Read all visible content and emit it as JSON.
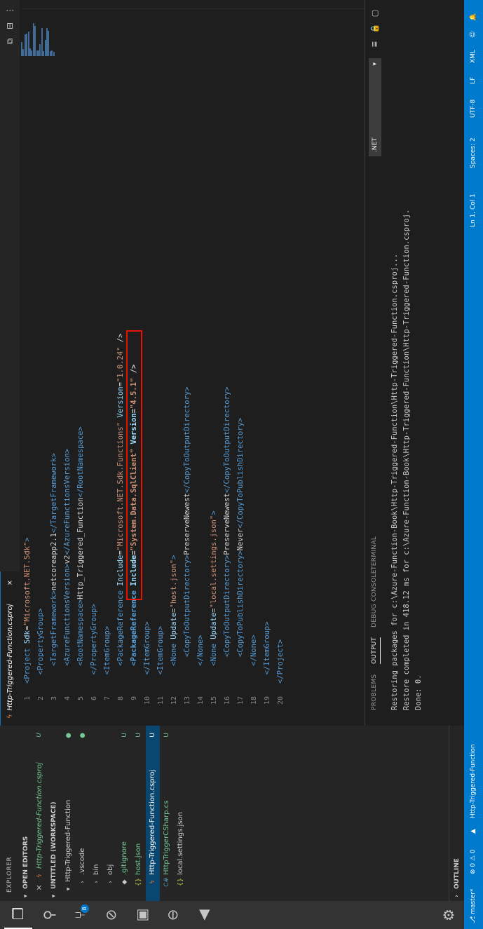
{
  "activity_bar": {
    "items": [
      {
        "name": "explorer-icon",
        "glyph": "❐"
      },
      {
        "name": "search-icon",
        "glyph": "⚲"
      },
      {
        "name": "source-control-icon",
        "glyph": "⑂",
        "badge": "8"
      },
      {
        "name": "debug-icon",
        "glyph": "⊘"
      },
      {
        "name": "extensions-icon",
        "glyph": "▣"
      },
      {
        "name": "azure-icon",
        "glyph": "⊖"
      },
      {
        "name": "deploy-icon",
        "glyph": "◀"
      }
    ],
    "settings_glyph": "⚙"
  },
  "sidebar": {
    "title": "EXPLORER",
    "open_editors_label": "OPEN EDITORS",
    "open_editor_item": {
      "close": "×",
      "name": "Http-Triggered-Function.csproj",
      "git": "U"
    },
    "workspace_label": "UNTITLED (WORKSPACE)",
    "tree": [
      {
        "name": "Http-Triggered-Function",
        "icon": "▾",
        "git": "●",
        "indent": 1
      },
      {
        "name": ".vscode",
        "icon": "›",
        "git": "●",
        "indent": 2
      },
      {
        "name": "bin",
        "icon": "›",
        "git": "",
        "indent": 2
      },
      {
        "name": "obj",
        "icon": "›",
        "git": "",
        "indent": 2
      },
      {
        "name": ".gitignore",
        "icon": "◆",
        "git": "U",
        "indent": 2
      },
      {
        "name": "host.json",
        "icon": "{}",
        "git": "U",
        "indent": 2
      },
      {
        "name": "Http-Triggered-Function.csproj",
        "icon": "ϟ",
        "git": "U",
        "indent": 2,
        "selected": true
      },
      {
        "name": "HttpTriggerCSharp.cs",
        "icon": "C#",
        "git": "U",
        "indent": 2
      },
      {
        "name": "local.settings.json",
        "icon": "{}",
        "git": "",
        "indent": 2
      }
    ],
    "outline_label": "OUTLINE"
  },
  "editor": {
    "tab_title": "Http-Triggered-Function.csproj",
    "tab_close": "×",
    "split_glyph": "⊟",
    "compare_glyph": "⧉",
    "more_glyph": "⋮",
    "lines": [
      {
        "n": "1",
        "code": "<Project Sdk=\"Microsoft.NET.Sdk\">"
      },
      {
        "n": "2",
        "code": "  <PropertyGroup>"
      },
      {
        "n": "3",
        "code": "    <TargetFramework>netcoreapp2.1</TargetFramework>"
      },
      {
        "n": "4",
        "code": "    <AzureFunctionsVersion>v2</AzureFunctionsVersion>"
      },
      {
        "n": "5",
        "code": "    <RootNamespace>Http_Triggered_Function</RootNamespace>"
      },
      {
        "n": "6",
        "code": "  </PropertyGroup>"
      },
      {
        "n": "7",
        "code": "  <ItemGroup>"
      },
      {
        "n": "8",
        "code": "    <PackageReference Include=\"Microsoft.NET.Sdk.Functions\" Version=\"1.0.24\" />"
      },
      {
        "n": "9",
        "code": "    <PackageReference Include=\"System.Data.SqlClient\" Version=\"4.5.1\" />"
      },
      {
        "n": "10",
        "code": "  </ItemGroup>"
      },
      {
        "n": "11",
        "code": "  <ItemGroup>"
      },
      {
        "n": "12",
        "code": "    <None Update=\"host.json\">"
      },
      {
        "n": "13",
        "code": "      <CopyToOutputDirectory>PreserveNewest</CopyToOutputDirectory>"
      },
      {
        "n": "14",
        "code": "    </None>"
      },
      {
        "n": "15",
        "code": "    <None Update=\"local.settings.json\">"
      },
      {
        "n": "16",
        "code": "      <CopyToOutputDirectory>PreserveNewest</CopyToOutputDirectory>"
      },
      {
        "n": "17",
        "code": "      <CopyToPublishDirectory>Never</CopyToPublishDirectory>"
      },
      {
        "n": "18",
        "code": "    </None>"
      },
      {
        "n": "19",
        "code": "  </ItemGroup>"
      },
      {
        "n": "20",
        "code": "</Project>"
      }
    ],
    "highlighted_line": "9"
  },
  "panel": {
    "tabs": [
      "PROBLEMS",
      "OUTPUT",
      "DEBUG CONSOLE",
      "TERMINAL"
    ],
    "active_tab": "OUTPUT",
    "output_channel": ".NET",
    "output_lines": [
      "Restoring packages for c:\\Azure-Function-Book\\Http-Triggered-Function\\Http-Triggered-Function.csproj...",
      "Restore completed in 418.12 ms for c:\\Azure-Function-Book\\Http-Triggered-Function\\Http-Triggered-Function.csproj.",
      "Done: 0."
    ],
    "icons": {
      "clear": "≣",
      "lock": "🔒",
      "copy": "▢",
      "collapse": "‹",
      "close": "×"
    }
  },
  "status_bar": {
    "left": [
      "⎇ master*",
      "⊗ 0 ⚠ 0",
      "▲",
      "Http-Triggered-Function"
    ],
    "right": [
      "Ln 1, Col 1",
      "Spaces: 2",
      "UTF-8",
      "LF",
      "XML",
      "☺",
      "🔔"
    ]
  },
  "colors": {
    "activity_bar": "#333333",
    "sidebar": "#252526",
    "editor": "#1e1e1e",
    "status_bar": "#007acc",
    "selection": "#094771",
    "highlight_box": "#e51400",
    "git_untracked": "#73c991"
  }
}
